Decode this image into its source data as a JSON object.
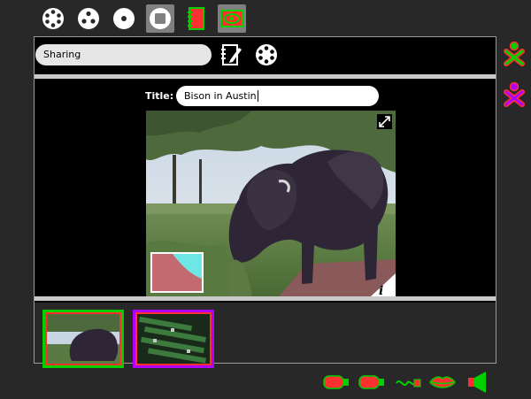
{
  "toolbar": {
    "tabs": [
      {
        "name": "neighborhood-icon",
        "label": ""
      },
      {
        "name": "group-icon",
        "label": ""
      },
      {
        "name": "home-icon",
        "label": ""
      },
      {
        "name": "activity-stop-icon",
        "label": ""
      },
      {
        "name": "journal-activity-icon",
        "label": ""
      },
      {
        "name": "view-icon",
        "label": ""
      }
    ],
    "active_tabs": [
      "activity-stop-icon",
      "view-icon"
    ]
  },
  "share": {
    "value": "Sharing"
  },
  "detail": {
    "title_label": "Title:",
    "title_value": "Bison in Austin"
  },
  "frame_icons": {
    "journal": "journal-icon",
    "share": "share-icon",
    "fullscreen": "fullscreen-icon",
    "info": "i"
  },
  "colors": {
    "accent_green": "#00d000",
    "accent_red": "#ff3030",
    "accent_purple": "#b000ff",
    "background": "#282828"
  },
  "thumbnails": [
    {
      "name": "bison-thumbnail",
      "border": "green-red"
    },
    {
      "name": "circuit-thumbnail",
      "border": "purple-red"
    }
  ],
  "buddies": [
    {
      "name": "buddy-green-icon"
    },
    {
      "name": "buddy-purple-icon"
    }
  ],
  "devices": [
    {
      "name": "usb-drive-icon"
    },
    {
      "name": "usb-drive-icon-2"
    },
    {
      "name": "network-icon"
    },
    {
      "name": "microphone-icon"
    },
    {
      "name": "speaker-icon"
    }
  ]
}
